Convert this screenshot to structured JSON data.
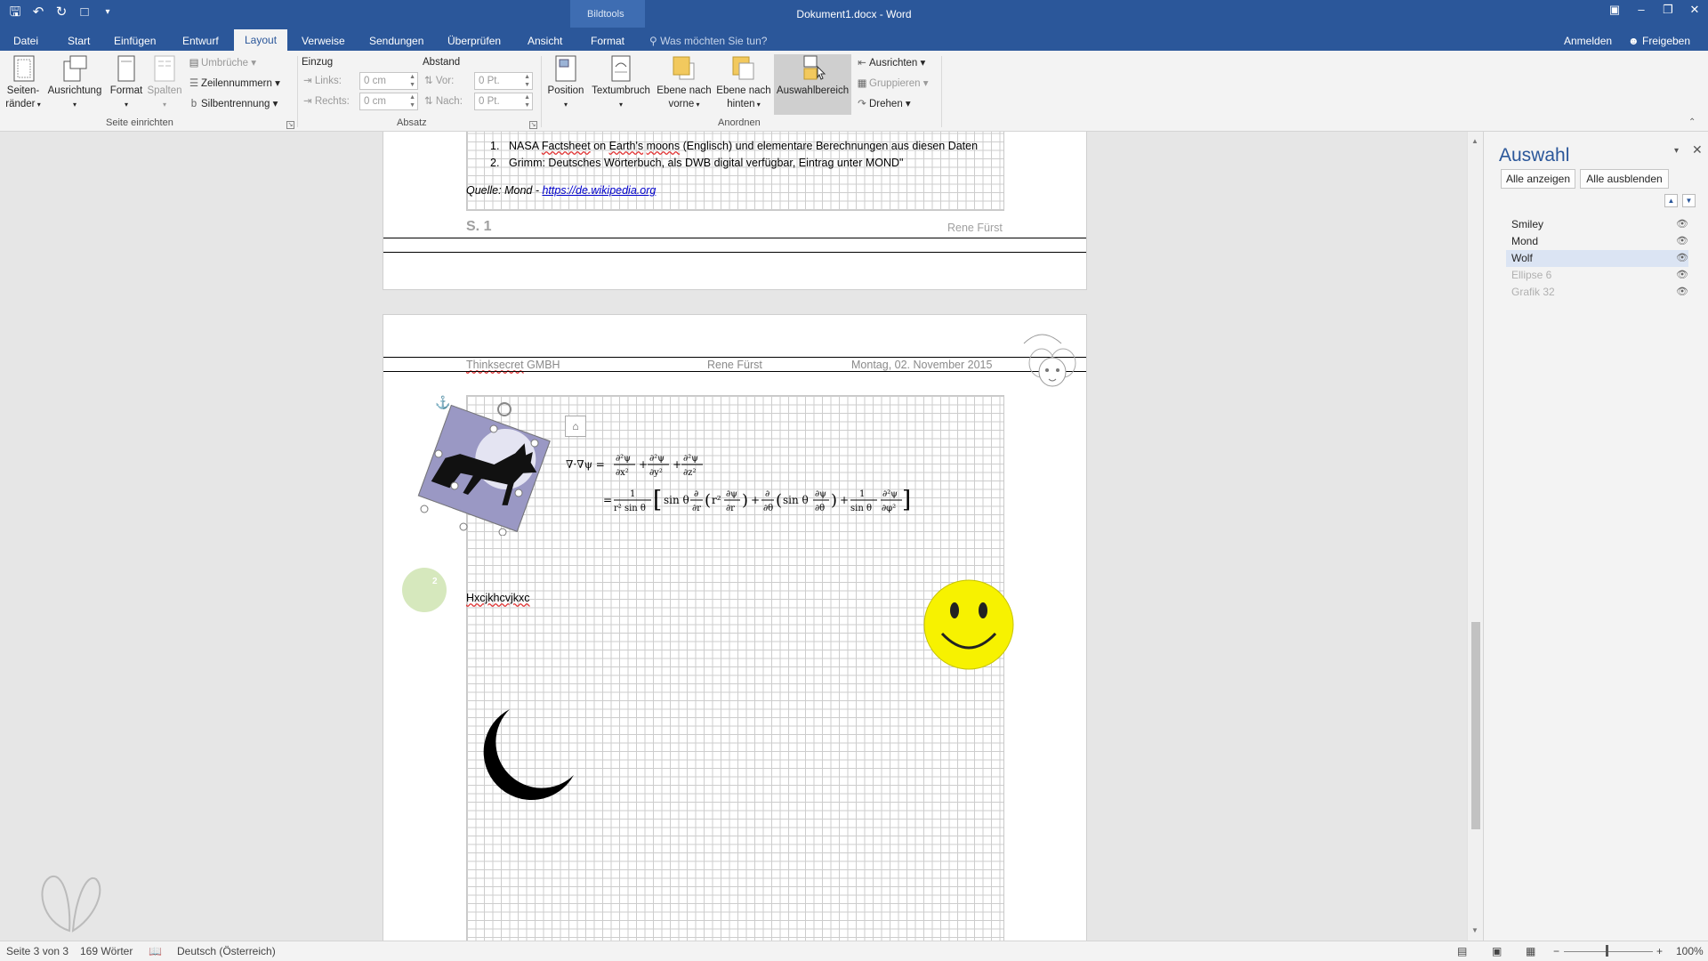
{
  "window": {
    "title": "Dokument1.docx - Word",
    "context_group": "Bildtools",
    "qat": [
      "save-icon",
      "undo-icon",
      "redo-icon",
      "new-doc-icon",
      "customize-icon"
    ],
    "controls": [
      "ribbon-display-icon",
      "minimize-icon",
      "restore-icon",
      "close-icon"
    ]
  },
  "tabs": [
    {
      "label": "Datei"
    },
    {
      "label": "Start"
    },
    {
      "label": "Einfügen"
    },
    {
      "label": "Entwurf"
    },
    {
      "label": "Layout"
    },
    {
      "label": "Verweise"
    },
    {
      "label": "Sendungen"
    },
    {
      "label": "Überprüfen"
    },
    {
      "label": "Ansicht"
    },
    {
      "label": "Format"
    }
  ],
  "active_tab": "Layout",
  "tell_me": "Was möchten Sie tun?",
  "account": {
    "signin": "Anmelden",
    "share": "Freigeben"
  },
  "ribbon": {
    "seite": {
      "label": "Seite einrichten",
      "margins_l1": "Seiten-",
      "margins_l2": "ränder",
      "orientation": "Ausrichtung",
      "size": "Format",
      "columns": "Spalten",
      "breaks": "Umbrüche",
      "line_numbers": "Zeilennummern",
      "hyphenation": "Silbentrennung"
    },
    "absatz": {
      "label": "Absatz",
      "indent_head": "Einzug",
      "spacing_head": "Abstand",
      "left_label": "Links:",
      "left_value": "0 cm",
      "right_label": "Rechts:",
      "right_value": "0 cm",
      "before_label": "Vor:",
      "before_value": "0 Pt.",
      "after_label": "Nach:",
      "after_value": "0 Pt."
    },
    "anordnen": {
      "label": "Anordnen",
      "position": "Position",
      "wrap": "Textumbruch",
      "forward_l1": "Ebene nach",
      "forward_l2": "vorne",
      "backward_l1": "Ebene nach",
      "backward_l2": "hinten",
      "selection_pane": "Auswahlbereich",
      "align": "Ausrichten",
      "group": "Gruppieren",
      "rotate": "Drehen"
    }
  },
  "document": {
    "page1": {
      "list_n1": "1.",
      "list_item1_parts": [
        "NASA ",
        "Factsheet",
        " on ",
        "Earth's",
        " ",
        "moons",
        " (Englisch) und elementare Berechnungen aus diesen Daten"
      ],
      "list_n2": "2.",
      "list_item2": "Grimm: Deutsches Wörterbuch, als DWB digital verfügbar, Eintrag unter MOND\"",
      "source_prefix": "Quelle: Mond - ",
      "source_link": "https://de.wikipedia.org",
      "footer_page": "S. 1",
      "footer_author": "Rene Fürst"
    },
    "page2": {
      "header_company": "Thinksecret",
      "header_company_suffix": " GMBH",
      "header_author": "Rene Fürst",
      "header_date": "Montag, 02. November 2015",
      "text_line": "Hxcjkhcvjkxc",
      "circle_number": "2",
      "equation_line1": "∇·∇ψ = ∂²ψ/∂x² + ∂²ψ/∂y² + ∂²ψ/∂z²",
      "equation_line2": "= 1/(r² sin θ) [ sin θ ∂/∂r (r² ∂ψ/∂r) + ∂/∂θ (sin θ ∂ψ/∂θ) + 1/sin θ ∂²ψ/∂φ² ]"
    }
  },
  "selection_pane": {
    "title": "Auswahl",
    "show_all": "Alle anzeigen",
    "hide_all": "Alle ausblenden",
    "items": [
      {
        "label": "Smiley",
        "selected": false,
        "dim": false
      },
      {
        "label": "Mond",
        "selected": false,
        "dim": false
      },
      {
        "label": "Wolf",
        "selected": true,
        "dim": false
      },
      {
        "label": "Ellipse 6",
        "selected": false,
        "dim": true
      },
      {
        "label": "Grafik 32",
        "selected": false,
        "dim": true
      }
    ]
  },
  "status": {
    "page": "Seite 3 von 3",
    "words": "169 Wörter",
    "language": "Deutsch (Österreich)",
    "zoom": "100%",
    "zoom_minus": "−",
    "zoom_plus": "+"
  },
  "colors": {
    "accent": "#2b579a",
    "ribbon_bg": "#f3f3f3",
    "smiley": "#f7f200",
    "selection": "#dbe4f3"
  }
}
